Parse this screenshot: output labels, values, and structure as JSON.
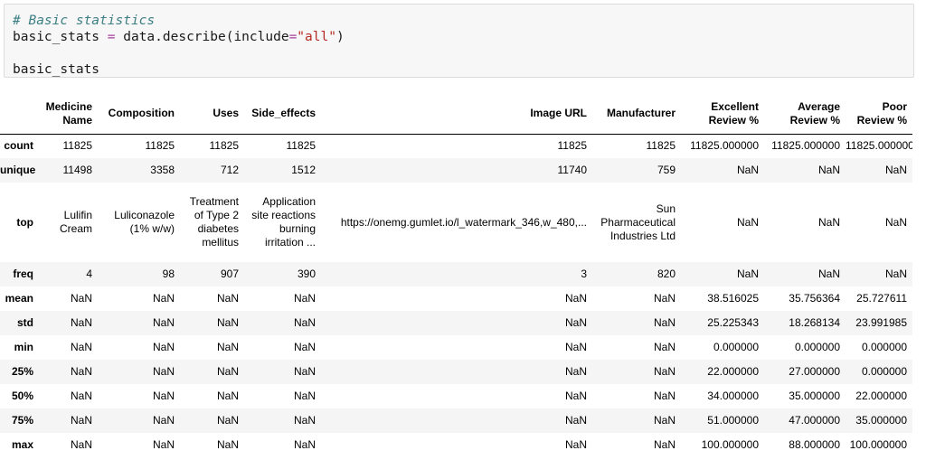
{
  "code": {
    "comment": "# Basic statistics",
    "var1": "basic_stats",
    "eq": "=",
    "call_prefix": "data.describe(include",
    "call_eq": "=",
    "arg": "\"all\"",
    "call_suffix": ")",
    "var2": "basic_stats"
  },
  "table": {
    "columns": [
      "",
      "Medicine Name",
      "Composition",
      "Uses",
      "Side_effects",
      "Image URL",
      "Manufacturer",
      "Excellent Review %",
      "Average Review %",
      "Poor Review %"
    ],
    "rows": [
      {
        "label": "count",
        "cells": [
          "11825",
          "11825",
          "11825",
          "11825",
          "11825",
          "11825",
          "11825.000000",
          "11825.000000",
          "11825.000000"
        ]
      },
      {
        "label": "unique",
        "cells": [
          "11498",
          "3358",
          "712",
          "1512",
          "11740",
          "759",
          "NaN",
          "NaN",
          "NaN"
        ]
      },
      {
        "label": "top",
        "cells": [
          "Lulifin Cream",
          "Luliconazole (1% w/w)",
          "Treatment of Type 2 diabetes mellitus",
          "Application site reactions burning irritation ...",
          "https://onemg.gumlet.io/l_watermark_346,w_480,...",
          "Sun Pharmaceutical Industries Ltd",
          "NaN",
          "NaN",
          "NaN"
        ]
      },
      {
        "label": "freq",
        "cells": [
          "4",
          "98",
          "907",
          "390",
          "3",
          "820",
          "NaN",
          "NaN",
          "NaN"
        ]
      },
      {
        "label": "mean",
        "cells": [
          "NaN",
          "NaN",
          "NaN",
          "NaN",
          "NaN",
          "NaN",
          "38.516025",
          "35.756364",
          "25.727611"
        ]
      },
      {
        "label": "std",
        "cells": [
          "NaN",
          "NaN",
          "NaN",
          "NaN",
          "NaN",
          "NaN",
          "25.225343",
          "18.268134",
          "23.991985"
        ]
      },
      {
        "label": "min",
        "cells": [
          "NaN",
          "NaN",
          "NaN",
          "NaN",
          "NaN",
          "NaN",
          "0.000000",
          "0.000000",
          "0.000000"
        ]
      },
      {
        "label": "25%",
        "cells": [
          "NaN",
          "NaN",
          "NaN",
          "NaN",
          "NaN",
          "NaN",
          "22.000000",
          "27.000000",
          "0.000000"
        ]
      },
      {
        "label": "50%",
        "cells": [
          "NaN",
          "NaN",
          "NaN",
          "NaN",
          "NaN",
          "NaN",
          "34.000000",
          "35.000000",
          "22.000000"
        ]
      },
      {
        "label": "75%",
        "cells": [
          "NaN",
          "NaN",
          "NaN",
          "NaN",
          "NaN",
          "NaN",
          "51.000000",
          "47.000000",
          "35.000000"
        ]
      },
      {
        "label": "max",
        "cells": [
          "NaN",
          "NaN",
          "NaN",
          "NaN",
          "NaN",
          "NaN",
          "100.000000",
          "88.000000",
          "100.000000"
        ]
      }
    ]
  }
}
